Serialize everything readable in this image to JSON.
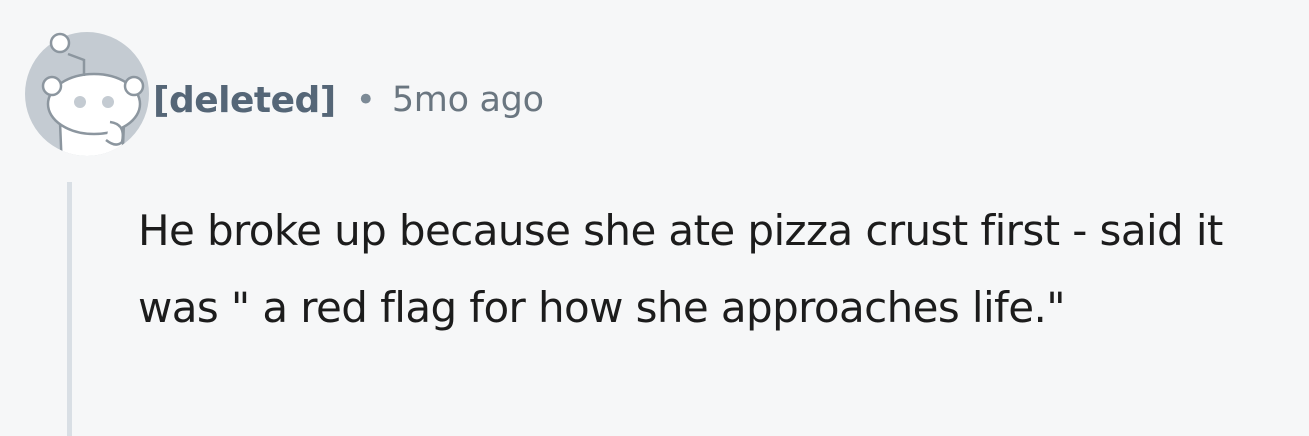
{
  "comment": {
    "avatar_icon": "snoo-avatar-icon",
    "author": "[deleted]",
    "separator": "•",
    "timestamp": "5mo ago",
    "body": "He broke up because she ate pizza crust first - said it was \" a red flag for how she approaches life.\""
  },
  "colors": {
    "background": "#f6f7f8",
    "author": "#556677",
    "timestamp": "#6a7680",
    "body_text": "#1c1c1c",
    "thread_line": "#d9dfe5"
  }
}
